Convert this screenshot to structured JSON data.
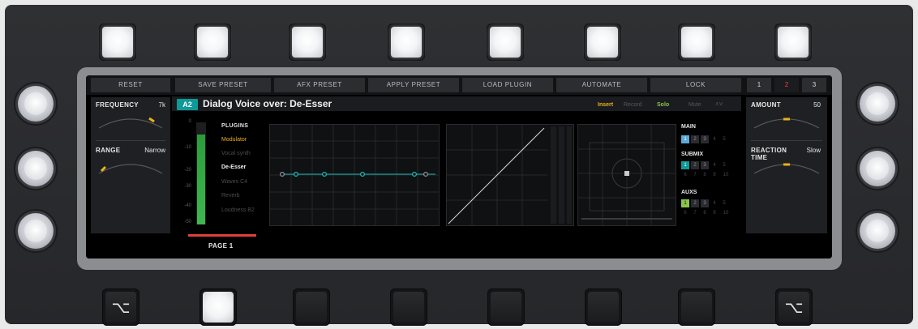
{
  "topbar": {
    "buttons": [
      "RESET",
      "SAVE PRESET",
      "AFX PRESET",
      "APPLY PRESET",
      "LOAD PLUGIN",
      "AUTOMATE",
      "LOCK"
    ],
    "pages": [
      "1",
      "2",
      "3"
    ]
  },
  "left_panel": {
    "frequency_label": "FREQUENCY",
    "frequency_value": "7k",
    "range_label": "RANGE",
    "range_value": "Narrow"
  },
  "header": {
    "badge": "A2",
    "title": "Dialog Voice over: De-Esser",
    "insert": "Insert",
    "record": "Record",
    "solo": "Solo",
    "mute": "Mute"
  },
  "meter": {
    "ticks": [
      "0",
      "-10",
      "-20",
      "-30",
      "-40",
      "-50"
    ],
    "level": 0.88
  },
  "plugins": {
    "heading": "PLUGINS",
    "items": [
      "Modulator",
      "Vocal synth",
      "De-Esser",
      "Waves C4",
      "Reverb",
      "Loudness B2"
    ]
  },
  "buses": {
    "main_label": "MAIN",
    "main": [
      "1",
      "2",
      "3",
      "4",
      "5"
    ],
    "submix_label": "SUBMIX",
    "submix": [
      "1",
      "2",
      "3",
      "4",
      "5",
      "6",
      "7",
      "8",
      "9",
      "10"
    ],
    "auxs_label": "AUXS",
    "auxs": [
      "1",
      "2",
      "3",
      "4",
      "5",
      "6",
      "7",
      "8",
      "9",
      "10"
    ]
  },
  "right_panel": {
    "amount_label": "AMOUNT",
    "amount_value": "50",
    "reaction_label_1": "REACTION",
    "reaction_label_2": "TIME",
    "reaction_value": "Slow"
  },
  "pagebar": {
    "page_label": "PAGE 1"
  },
  "colors": {
    "teal": "#0f9a9a",
    "amber": "#e8b21a",
    "green": "#8bc34a",
    "red": "#ff3b30",
    "blue": "#5aa9d6"
  }
}
